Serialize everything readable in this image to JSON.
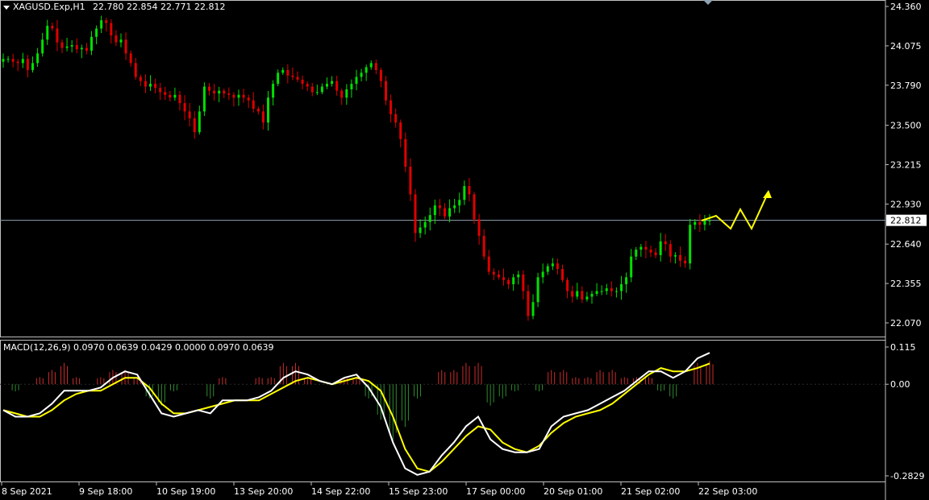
{
  "header": {
    "symbol_timeframe": "XAGUSD.Exp,H1",
    "ohlc": "22.780 22.854 22.771 22.812",
    "macd_label": "MACD(12,26,9) 0.0970 0.0639 0.0429 0.0000 0.0970 0.0639"
  },
  "colors": {
    "background": "#000000",
    "bull_candle": "#00e000",
    "bear_candle": "#e00000",
    "macd_line": "#ffffff",
    "signal_line": "#ffff00",
    "forecast_arrow": "#ffff00",
    "histogram_up": "#cc2b2b",
    "histogram_down": "#2e8b2e",
    "axis_text": "#ffffff",
    "current_price_line": "#8fa3b3"
  },
  "chart_data": [
    {
      "type": "candlestick",
      "symbol": "XAGUSD.Exp",
      "timeframe": "H1",
      "current_price": 22.812,
      "y_ticks": [
        24.36,
        24.075,
        23.79,
        23.5,
        23.215,
        22.93,
        22.64,
        22.355,
        22.07
      ],
      "x_tick_labels": [
        "8 Sep 2021",
        "9 Sep 18:00",
        "10 Sep 19:00",
        "13 Sep 20:00",
        "14 Sep 22:00",
        "15 Sep 23:00",
        "17 Sep 00:00",
        "20 Sep 01:00",
        "21 Sep 02:00",
        "22 Sep 03:00"
      ],
      "close_path": [
        23.98,
        23.98,
        23.96,
        23.95,
        23.98,
        23.9,
        23.95,
        24.02,
        24.12,
        24.22,
        24.2,
        24.1,
        24.06,
        24.07,
        24.08,
        24.05,
        24.06,
        24.04,
        24.14,
        24.2,
        24.26,
        24.24,
        24.15,
        24.1,
        24.12,
        24.02,
        23.95,
        23.85,
        23.82,
        23.78,
        23.8,
        23.77,
        23.74,
        23.72,
        23.7,
        23.72,
        23.66,
        23.6,
        23.55,
        23.45,
        23.6,
        23.78,
        23.75,
        23.73,
        23.75,
        23.73,
        23.72,
        23.7,
        23.72,
        23.7,
        23.68,
        23.62,
        23.6,
        23.52,
        23.7,
        23.8,
        23.88,
        23.9,
        23.86,
        23.85,
        23.83,
        23.8,
        23.78,
        23.74,
        23.74,
        23.78,
        23.8,
        23.82,
        23.75,
        23.7,
        23.76,
        23.8,
        23.85,
        23.88,
        23.92,
        23.95,
        23.9,
        23.82,
        23.68,
        23.58,
        23.52,
        23.4,
        23.2,
        23.0,
        22.72,
        22.76,
        22.8,
        22.85,
        22.92,
        22.9,
        22.84,
        22.9,
        22.92,
        22.96,
        23.06,
        23.0,
        22.82,
        22.7,
        22.55,
        22.44,
        22.42,
        22.4,
        22.38,
        22.35,
        22.4,
        22.42,
        22.3,
        22.12,
        22.22,
        22.4,
        22.44,
        22.48,
        22.5,
        22.46,
        22.38,
        22.3,
        22.26,
        22.3,
        22.24,
        22.26,
        22.28,
        22.3,
        22.3,
        22.32,
        22.3,
        22.3,
        22.35,
        22.4,
        22.55,
        22.6,
        22.62,
        22.6,
        22.58,
        22.56,
        22.66,
        22.64,
        22.55,
        22.56,
        22.52,
        22.5,
        22.78,
        22.8,
        22.78,
        22.81,
        22.812
      ],
      "price_range": [
        22.0,
        24.4
      ]
    },
    {
      "type": "line",
      "indicator": "MACD(12,26,9)",
      "macd": 0.097,
      "signal": 0.0639,
      "y_ticks": [
        0.115,
        0.0,
        -0.2829
      ],
      "macd_path": [
        -0.08,
        -0.1,
        -0.1,
        -0.09,
        -0.06,
        -0.02,
        -0.02,
        -0.02,
        -0.01,
        0.02,
        0.04,
        0.03,
        -0.03,
        -0.09,
        -0.1,
        -0.09,
        -0.08,
        -0.09,
        -0.05,
        -0.05,
        -0.05,
        -0.04,
        -0.02,
        0.02,
        0.04,
        0.03,
        0.01,
        0.0,
        0.02,
        0.03,
        -0.01,
        -0.07,
        -0.18,
        -0.26,
        -0.28,
        -0.27,
        -0.22,
        -0.18,
        -0.13,
        -0.1,
        -0.17,
        -0.2,
        -0.21,
        -0.21,
        -0.2,
        -0.13,
        -0.1,
        -0.09,
        -0.08,
        -0.06,
        -0.04,
        -0.02,
        0.01,
        0.04,
        0.04,
        0.02,
        0.04,
        0.08,
        0.097
      ],
      "signal_path": [
        -0.08,
        -0.09,
        -0.1,
        -0.1,
        -0.08,
        -0.05,
        -0.03,
        -0.02,
        -0.02,
        0.0,
        0.02,
        0.02,
        -0.01,
        -0.06,
        -0.09,
        -0.09,
        -0.08,
        -0.07,
        -0.06,
        -0.05,
        -0.05,
        -0.05,
        -0.03,
        -0.01,
        0.01,
        0.02,
        0.01,
        0.0,
        0.01,
        0.02,
        0.01,
        -0.02,
        -0.1,
        -0.2,
        -0.26,
        -0.27,
        -0.24,
        -0.2,
        -0.16,
        -0.13,
        -0.14,
        -0.18,
        -0.2,
        -0.21,
        -0.19,
        -0.15,
        -0.12,
        -0.1,
        -0.09,
        -0.08,
        -0.06,
        -0.03,
        0.0,
        0.03,
        0.05,
        0.04,
        0.04,
        0.05,
        0.0639
      ],
      "range": [
        -0.3,
        0.13
      ]
    }
  ]
}
